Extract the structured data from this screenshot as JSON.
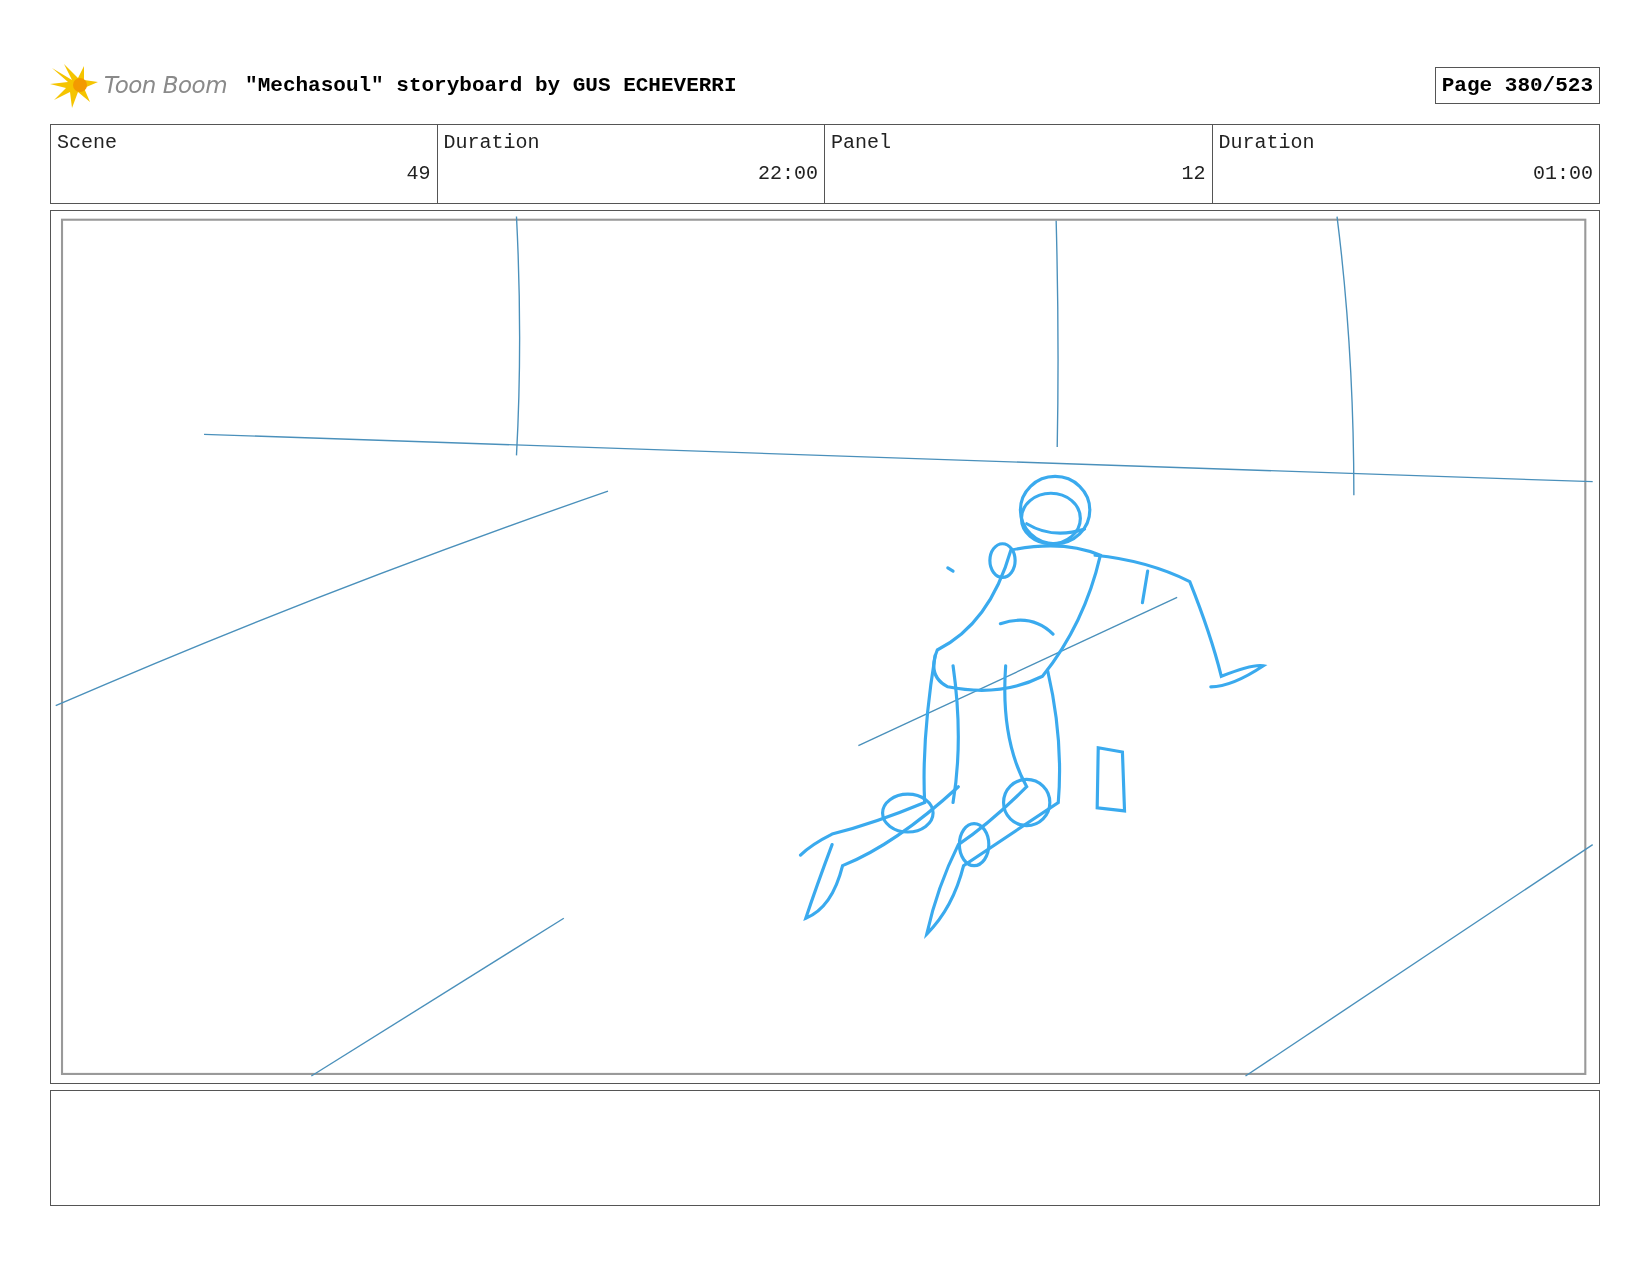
{
  "header": {
    "logo_text": "Toon Boom",
    "title": "\"Mechasoul\" storyboard by GUS ECHEVERRI",
    "page": "Page 380/523"
  },
  "info": [
    {
      "heading": "Scene",
      "entry": "49"
    },
    {
      "heading": "Duration",
      "entry": "22:00"
    },
    {
      "heading": "Panel",
      "entry": "12"
    },
    {
      "heading": "Duration",
      "entry": "01:00"
    }
  ]
}
